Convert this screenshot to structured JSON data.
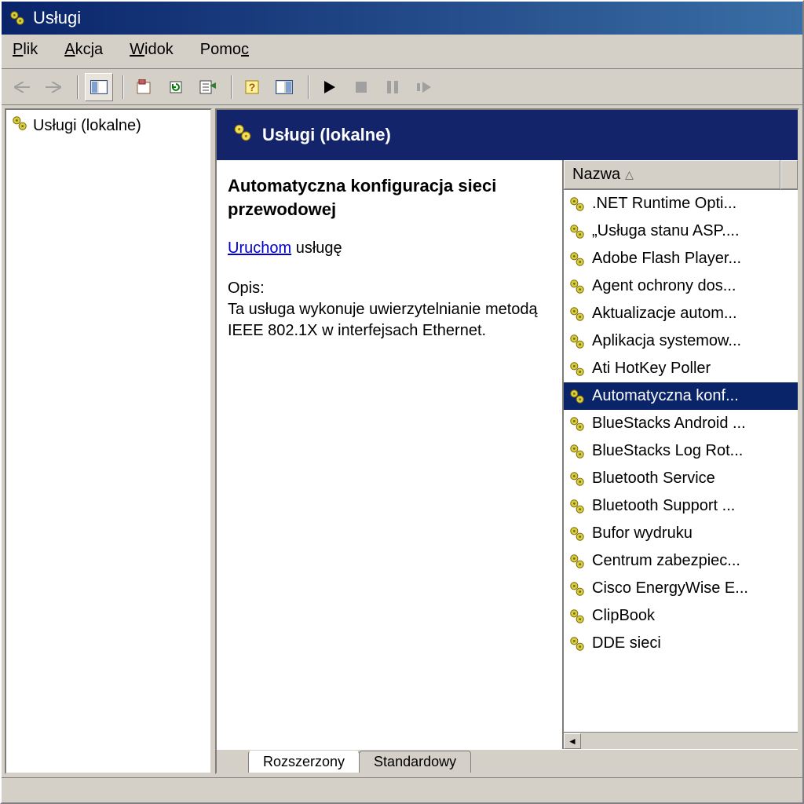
{
  "window": {
    "title": "Usługi"
  },
  "menu": {
    "plik": "Plik",
    "akcja": "Akcja",
    "widok": "Widok",
    "pomoc": "Pomoc"
  },
  "tree": {
    "root_label": "Usługi (lokalne)"
  },
  "pane": {
    "header": "Usługi (lokalne)"
  },
  "detail": {
    "title": "Automatyczna konfiguracja sieci przewodowej",
    "action_link": "Uruchom",
    "action_suffix": " usługę",
    "desc_label": "Opis:",
    "desc_text": "Ta usługa wykonuje uwierzytelnianie metodą IEEE 802.1X w interfejsach Ethernet."
  },
  "columns": {
    "name": "Nazwa"
  },
  "services": [
    {
      "name": ".NET Runtime Opti..."
    },
    {
      "name": "„Usługa stanu ASP...."
    },
    {
      "name": "Adobe Flash Player..."
    },
    {
      "name": "Agent ochrony dos..."
    },
    {
      "name": "Aktualizacje autom..."
    },
    {
      "name": "Aplikacja systemow..."
    },
    {
      "name": "Ati HotKey Poller"
    },
    {
      "name": "Automatyczna konf...",
      "selected": true
    },
    {
      "name": "BlueStacks Android ..."
    },
    {
      "name": "BlueStacks Log Rot..."
    },
    {
      "name": "Bluetooth Service"
    },
    {
      "name": "Bluetooth Support ..."
    },
    {
      "name": "Bufor wydruku"
    },
    {
      "name": "Centrum zabezpiec..."
    },
    {
      "name": "Cisco EnergyWise E..."
    },
    {
      "name": "ClipBook"
    },
    {
      "name": "DDE sieci"
    }
  ],
  "tabs": {
    "extended": "Rozszerzony",
    "standard": "Standardowy"
  }
}
